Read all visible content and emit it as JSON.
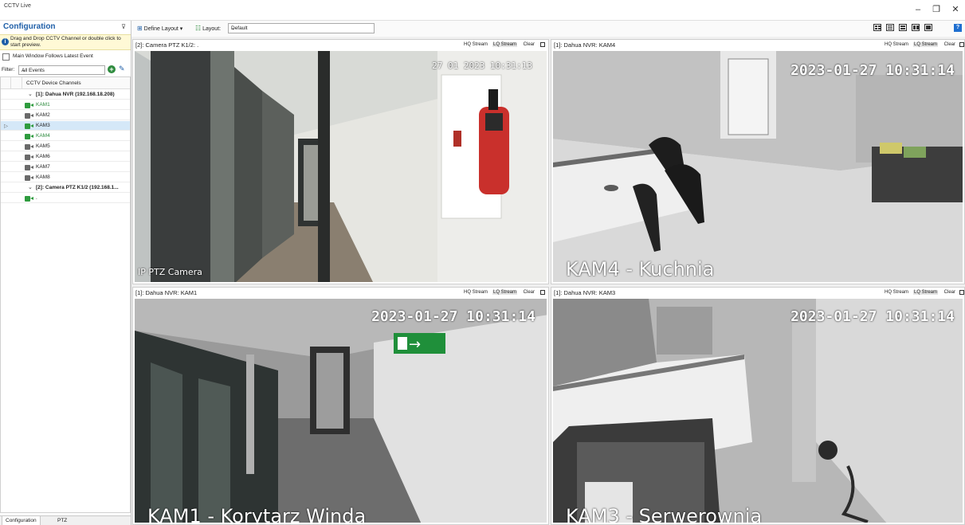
{
  "window": {
    "title": "CCTV Live",
    "min": "–",
    "restore": "❐",
    "close": "✕"
  },
  "config": {
    "title": "Configuration",
    "pin": "⊽",
    "info": "Drag and Drop CCTV Channel or double click to start preview.",
    "follow_label": "Main Window Follows Latest Event",
    "filter_label": "Filter:",
    "filter_value": "All Events",
    "tree_header": "CCTV Device Channels",
    "groups": [
      {
        "label": "[1]: Dahua NVR (192.168.18.208)"
      },
      {
        "label": "[2]: Camera PTZ K1/2 (192.168.1..."
      }
    ],
    "channels": [
      {
        "label": "KAM1",
        "active": true
      },
      {
        "label": "KAM2",
        "active": false
      },
      {
        "label": "KAM3",
        "active": true
      },
      {
        "label": "KAM4",
        "active": true
      },
      {
        "label": "KAM5",
        "active": false
      },
      {
        "label": "KAM6",
        "active": false
      },
      {
        "label": "KAM7",
        "active": false
      },
      {
        "label": "KAM8",
        "active": false
      },
      {
        "label": ".",
        "active": true
      }
    ],
    "tabs": [
      "Configuration",
      "PTZ"
    ]
  },
  "toolbar": {
    "define_layout": "Define Layout ▾",
    "layout_label": "Layout:",
    "layout_value": "Default"
  },
  "panel_buttons": {
    "hq": "HQ Stream",
    "lq": "LQ Stream",
    "clear": "Clear"
  },
  "panels": [
    {
      "title": "[2]: Camera PTZ K1/2: .",
      "timestamp": "27 01 2023 10:31:13",
      "osd": "IP PTZ Camera"
    },
    {
      "title": "[1]: Dahua NVR: KAM4",
      "timestamp": "2023-01-27 10:31:14",
      "osd": "KAM4 - Kuchnia"
    },
    {
      "title": "[1]: Dahua NVR: KAM1",
      "timestamp": "2023-01-27 10:31:14",
      "osd": "KAM1 - Korytarz Winda"
    },
    {
      "title": "[1]: Dahua NVR: KAM3",
      "timestamp": "2023-01-27 10:31:14",
      "osd": "KAM3 - Serwerownia"
    }
  ],
  "colors": {
    "accent": "#1f5fa8",
    "online": "#2e9b3e",
    "selected_row": "#d5e8f8"
  }
}
